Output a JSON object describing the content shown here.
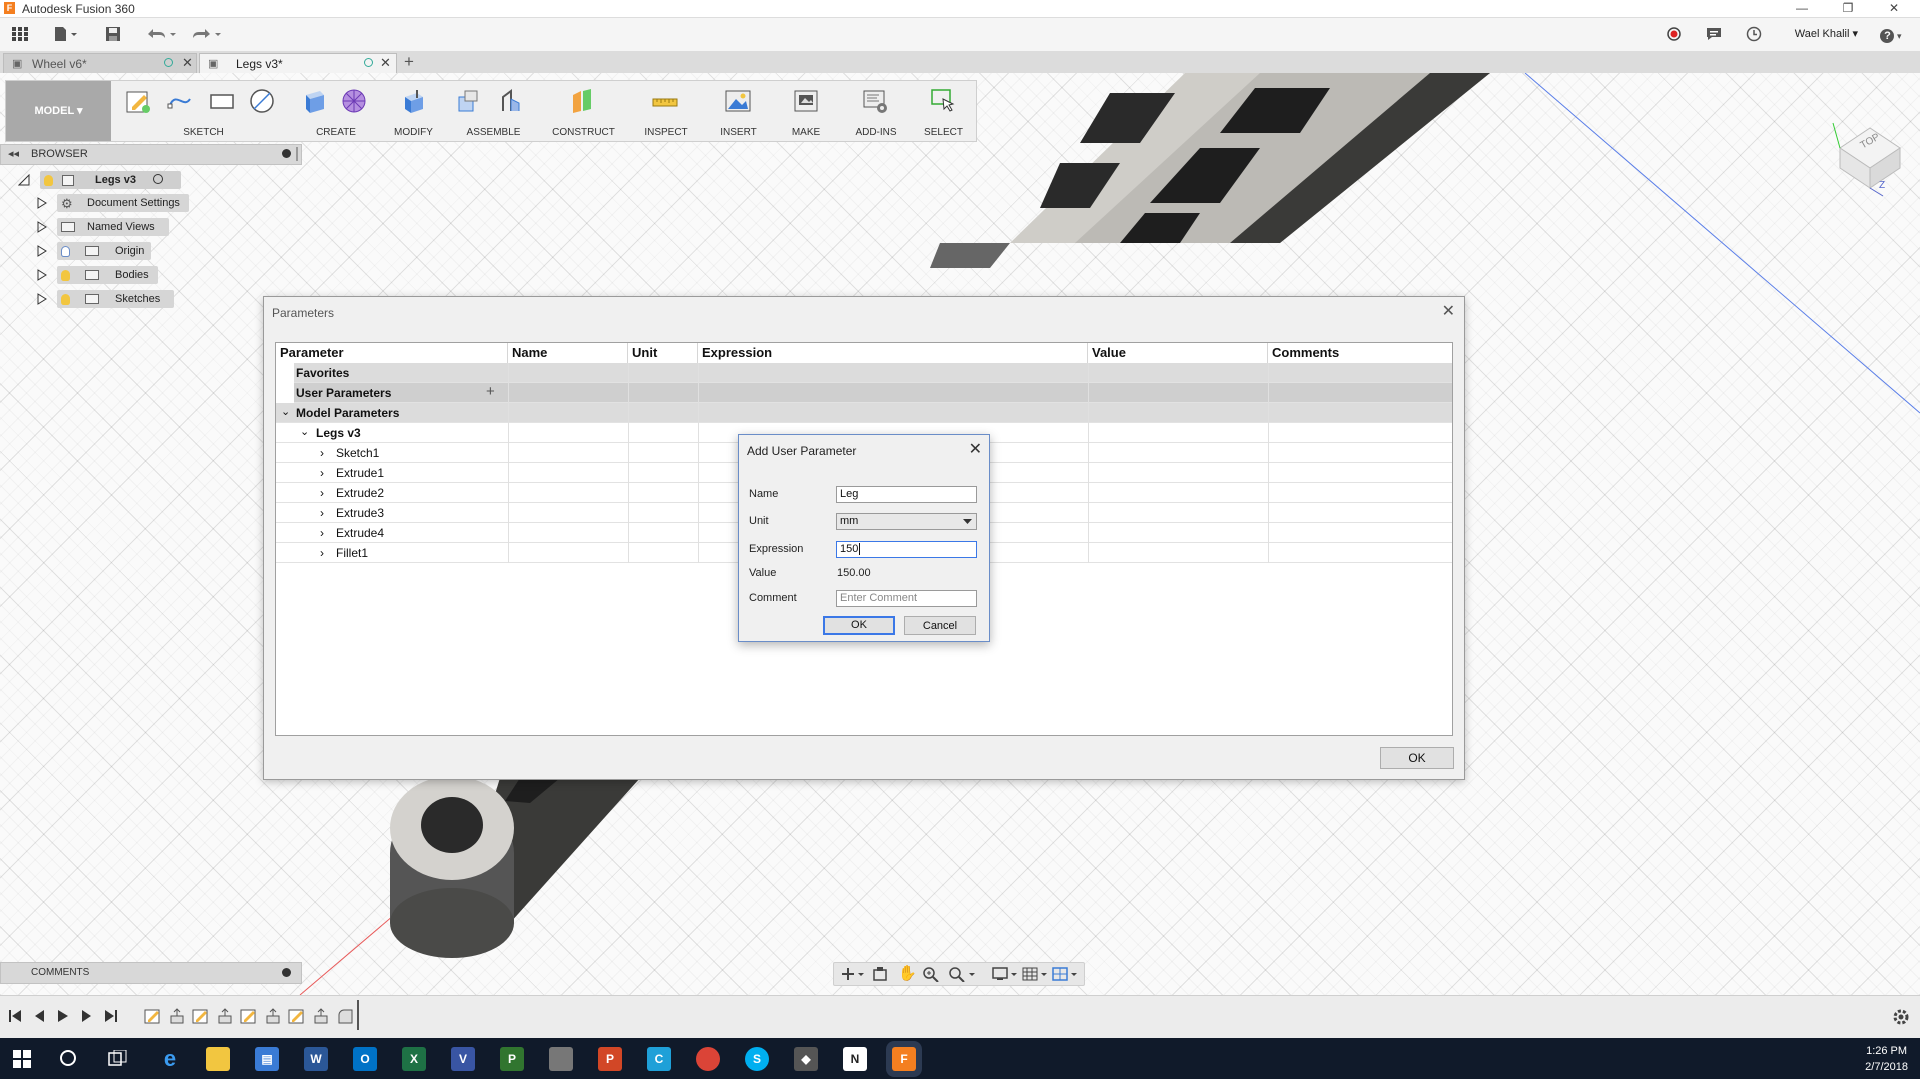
{
  "window": {
    "title": "Autodesk Fusion 360",
    "logo_letter": "F",
    "minimize": "—",
    "restore": "❐",
    "close": "✕"
  },
  "quickbar": {
    "user_name": "Wael Khalil",
    "help": "?"
  },
  "tabs": [
    {
      "label": "Wheel v6*",
      "active": false
    },
    {
      "label": "Legs v3*",
      "active": true
    }
  ],
  "ribbon": {
    "workspace": "MODEL",
    "groups": [
      {
        "label": "SKETCH"
      },
      {
        "label": "CREATE"
      },
      {
        "label": "MODIFY"
      },
      {
        "label": "ASSEMBLE"
      },
      {
        "label": "CONSTRUCT"
      },
      {
        "label": "INSPECT"
      },
      {
        "label": "INSERT"
      },
      {
        "label": "MAKE"
      },
      {
        "label": "ADD-INS"
      },
      {
        "label": "SELECT"
      }
    ]
  },
  "browser": {
    "title": "BROWSER",
    "root": "Legs v3",
    "items": [
      {
        "label": "Document Settings"
      },
      {
        "label": "Named Views"
      },
      {
        "label": "Origin"
      },
      {
        "label": "Bodies"
      },
      {
        "label": "Sketches"
      }
    ]
  },
  "parameters_dialog": {
    "title": "Parameters",
    "columns": [
      "Parameter",
      "Name",
      "Unit",
      "Expression",
      "Value",
      "Comments"
    ],
    "sections": {
      "favorites": "Favorites",
      "user_parameters": "User Parameters",
      "add_symbol": "+",
      "model_parameters": "Model Parameters",
      "component": "Legs v3"
    },
    "features": [
      "Sketch1",
      "Extrude1",
      "Extrude2",
      "Extrude3",
      "Extrude4",
      "Fillet1"
    ],
    "ok_label": "OK"
  },
  "add_user_parameter": {
    "title": "Add User Parameter",
    "name_label": "Name",
    "name_value": "Leg",
    "unit_label": "Unit",
    "unit_value": "mm",
    "expression_label": "Expression",
    "expression_value": "150",
    "value_label": "Value",
    "value_value": "150.00",
    "comment_label": "Comment",
    "comment_placeholder": "Enter Comment",
    "ok_label": "OK",
    "cancel_label": "Cancel"
  },
  "comments_panel": {
    "title": "COMMENTS"
  },
  "viewcube": {
    "face_label": "TOP",
    "axis_z": "Z"
  },
  "taskbar": {
    "time": "1:26 PM",
    "date": "2/7/2018"
  },
  "colors": {
    "accent_blue": "#3b78e7",
    "fusion_orange": "#f47f20",
    "taskbar": "#101a2a"
  }
}
